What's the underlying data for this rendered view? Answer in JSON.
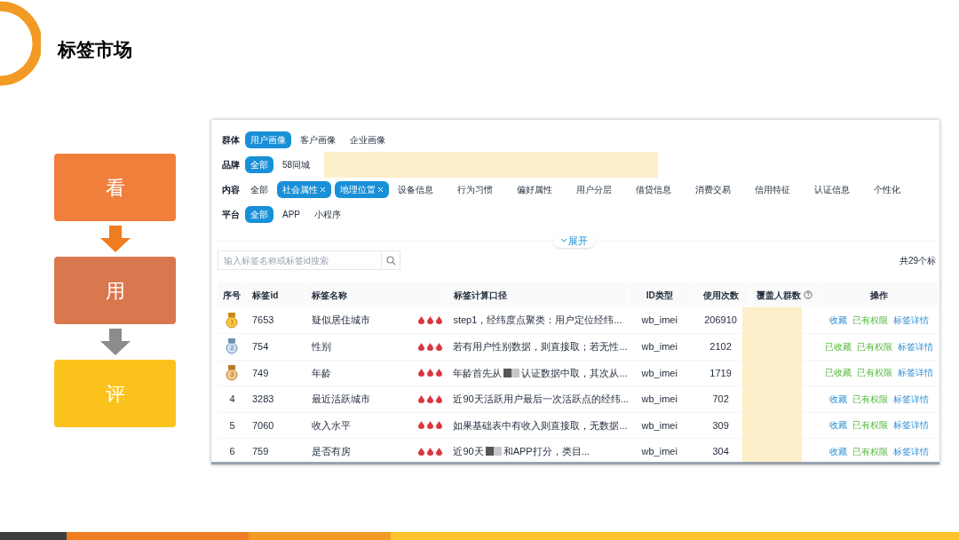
{
  "title": "标签市场",
  "flow": [
    {
      "label": "看",
      "color": "#f07f3c"
    },
    {
      "label": "用",
      "color": "#d9774f"
    },
    {
      "label": "评",
      "color": "#fbc21c"
    }
  ],
  "filters": [
    {
      "label": "群体",
      "options": [
        {
          "label": "用户画像",
          "selected": true,
          "removable": false
        },
        {
          "label": "客户画像",
          "selected": false,
          "removable": false
        },
        {
          "label": "企业画像",
          "selected": false,
          "removable": false
        }
      ],
      "redacted": false
    },
    {
      "label": "品牌",
      "options": [
        {
          "label": "全部",
          "selected": true,
          "removable": false
        },
        {
          "label": "58同城",
          "selected": false,
          "removable": false
        }
      ],
      "redacted": true
    },
    {
      "label": "内容",
      "options": [
        {
          "label": "全部",
          "selected": false,
          "removable": false
        },
        {
          "label": "社会属性",
          "selected": true,
          "removable": true
        },
        {
          "label": "地理位置",
          "selected": true,
          "removable": true
        },
        {
          "label": "设备信息",
          "selected": false,
          "removable": false
        },
        {
          "label": "行为习惯",
          "selected": false,
          "removable": false
        },
        {
          "label": "偏好属性",
          "selected": false,
          "removable": false
        },
        {
          "label": "用户分层",
          "selected": false,
          "removable": false
        },
        {
          "label": "借贷信息",
          "selected": false,
          "removable": false
        },
        {
          "label": "消费交易",
          "selected": false,
          "removable": false
        },
        {
          "label": "信用特征",
          "selected": false,
          "removable": false
        },
        {
          "label": "认证信息",
          "selected": false,
          "removable": false
        },
        {
          "label": "个性化",
          "selected": false,
          "removable": false
        }
      ],
      "redacted": false
    },
    {
      "label": "平台",
      "options": [
        {
          "label": "全部",
          "selected": true,
          "removable": false
        },
        {
          "label": "APP",
          "selected": false,
          "removable": false
        },
        {
          "label": "小程序",
          "selected": false,
          "removable": false
        }
      ],
      "redacted": false
    }
  ],
  "expand": "展开",
  "search": {
    "placeholder": "输入标签名称或标签id搜索"
  },
  "total": "共29个标",
  "table": {
    "columns": [
      "序号",
      "标签id",
      "标签名称",
      "标签计算口径",
      "ID类型",
      "使用次数",
      "覆盖人群数",
      "操作"
    ],
    "rows": [
      {
        "rank": "1",
        "kind": "gold",
        "id": "7653",
        "name": "疑似居住城市",
        "calc": [
          "step1，经纬度点聚类：用户定位经纬..."
        ],
        "id_type": "wb_imei",
        "uses": "206910",
        "favorite": {
          "label": "收藏",
          "on": false
        },
        "permission": "已有权限",
        "detail": "标签详情"
      },
      {
        "rank": "2",
        "kind": "silver",
        "id": "754",
        "name": "性别",
        "calc": [
          "若有用户性别数据，则直接取；若无性..."
        ],
        "id_type": "wb_imei",
        "uses": "2102",
        "favorite": {
          "label": "已收藏",
          "on": true
        },
        "permission": "已有权限",
        "detail": "标签详情"
      },
      {
        "rank": "3",
        "kind": "bronze",
        "id": "749",
        "name": "年龄",
        "calc": [
          "年龄首先从",
          "认证数据中取，其次从..."
        ],
        "id_type": "wb_imei",
        "uses": "1719",
        "favorite": {
          "label": "已收藏",
          "on": true
        },
        "permission": "已有权限",
        "detail": "标签详情"
      },
      {
        "rank": "4",
        "kind": "plain",
        "id": "3283",
        "name": "最近活跃城市",
        "calc": [
          "近90天活跃用户最后一次活跃点的经纬..."
        ],
        "id_type": "wb_imei",
        "uses": "702",
        "favorite": {
          "label": "收藏",
          "on": false
        },
        "permission": "已有权限",
        "detail": "标签详情"
      },
      {
        "rank": "5",
        "kind": "plain",
        "id": "7060",
        "name": "收入水平",
        "calc": [
          "如果基础表中有收入则直接取，无数据..."
        ],
        "id_type": "wb_imei",
        "uses": "309",
        "favorite": {
          "label": "收藏",
          "on": false
        },
        "permission": "已有权限",
        "detail": "标签详情"
      },
      {
        "rank": "6",
        "kind": "plain",
        "id": "759",
        "name": "是否有房",
        "calc": [
          "近90天",
          "和APP打分，类目..."
        ],
        "id_type": "wb_imei",
        "uses": "304",
        "favorite": {
          "label": "收藏",
          "on": false
        },
        "permission": "已有权限",
        "detail": "标签详情"
      }
    ]
  }
}
